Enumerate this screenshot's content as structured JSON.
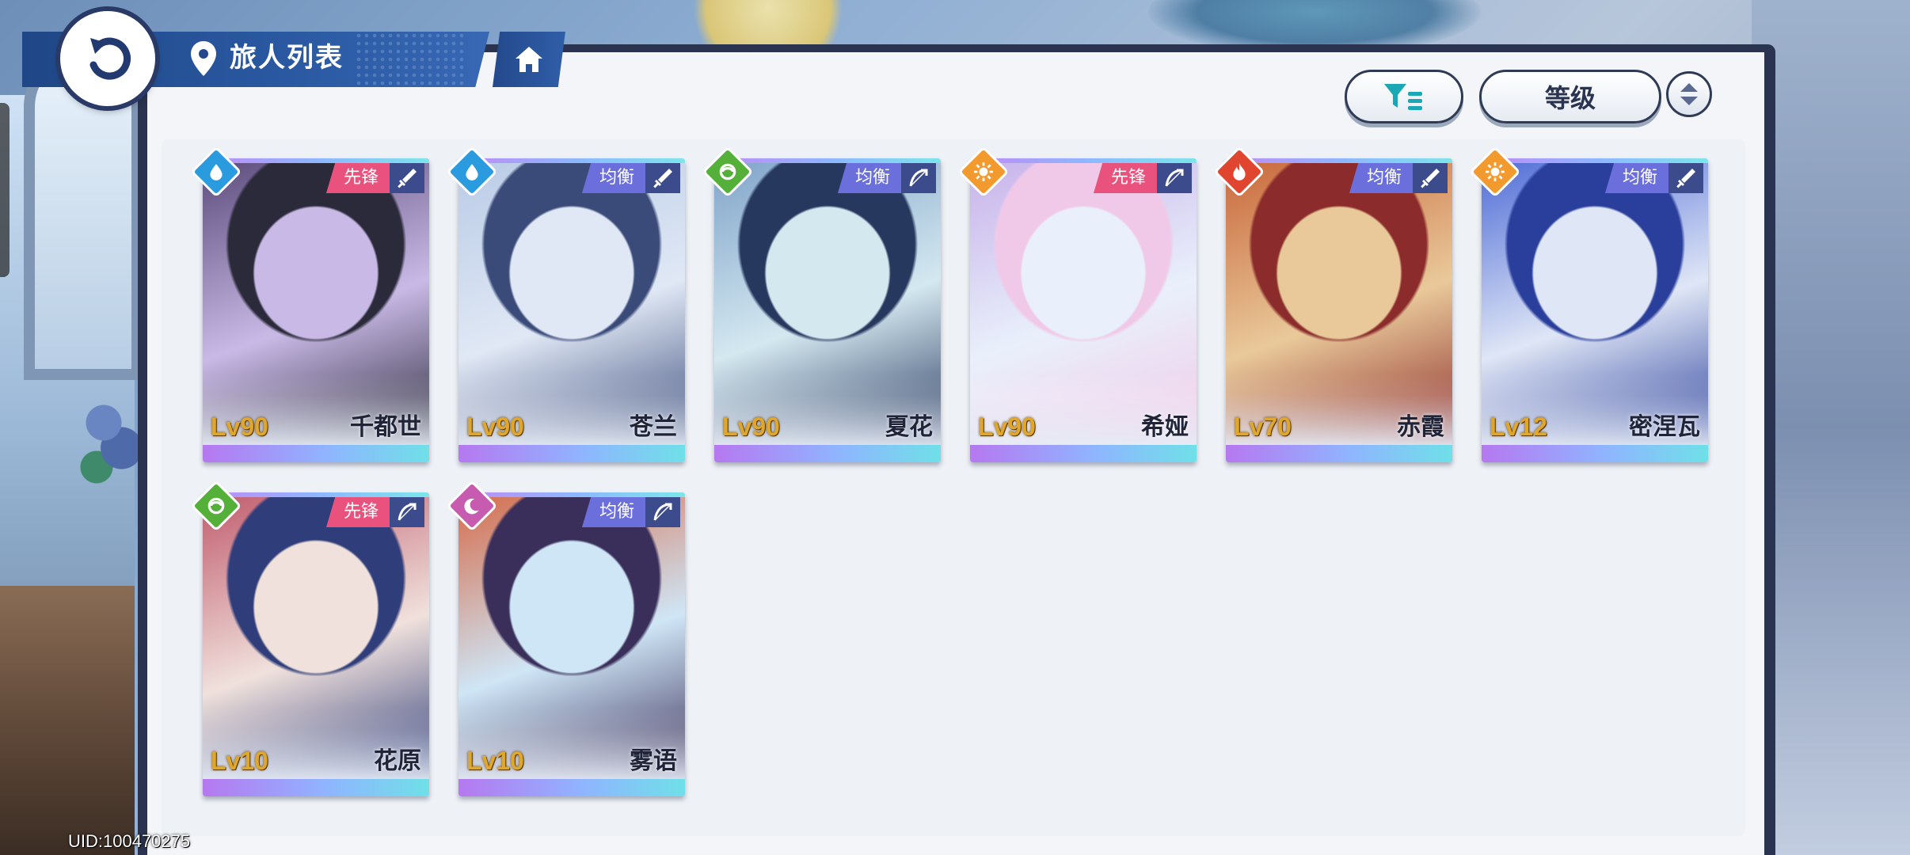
{
  "header": {
    "title": "旅人列表"
  },
  "controls": {
    "sort_label": "等级"
  },
  "footer": {
    "uid": "UID:100470275"
  },
  "colors": {
    "water": "#2b9be0",
    "wind": "#55b03a",
    "light": "#f29a2e",
    "fire": "#e0452f",
    "dark": "#c75bb0",
    "vanguard": "#e8527c",
    "balance": "#6b6fdc"
  },
  "cards": [
    {
      "name": "千都世",
      "level": "Lv90",
      "role": "先锋",
      "element": "water-icon",
      "weapon": "sword-icon"
    },
    {
      "name": "苍兰",
      "level": "Lv90",
      "role": "均衡",
      "element": "water-icon",
      "weapon": "sword-icon"
    },
    {
      "name": "夏花",
      "level": "Lv90",
      "role": "均衡",
      "element": "wind-icon",
      "weapon": "bow-icon"
    },
    {
      "name": "希娅",
      "level": "Lv90",
      "role": "先锋",
      "element": "light-icon",
      "weapon": "bow-icon"
    },
    {
      "name": "赤霞",
      "level": "Lv70",
      "role": "均衡",
      "element": "fire-icon",
      "weapon": "sword-icon"
    },
    {
      "name": "密涅瓦",
      "level": "Lv12",
      "role": "均衡",
      "element": "light-icon",
      "weapon": "sword-icon"
    },
    {
      "name": "花原",
      "level": "Lv10",
      "role": "先锋",
      "element": "wind-icon",
      "weapon": "bow-icon"
    },
    {
      "name": "雾语",
      "level": "Lv10",
      "role": "均衡",
      "element": "dark-icon",
      "weapon": "bow-icon"
    }
  ]
}
